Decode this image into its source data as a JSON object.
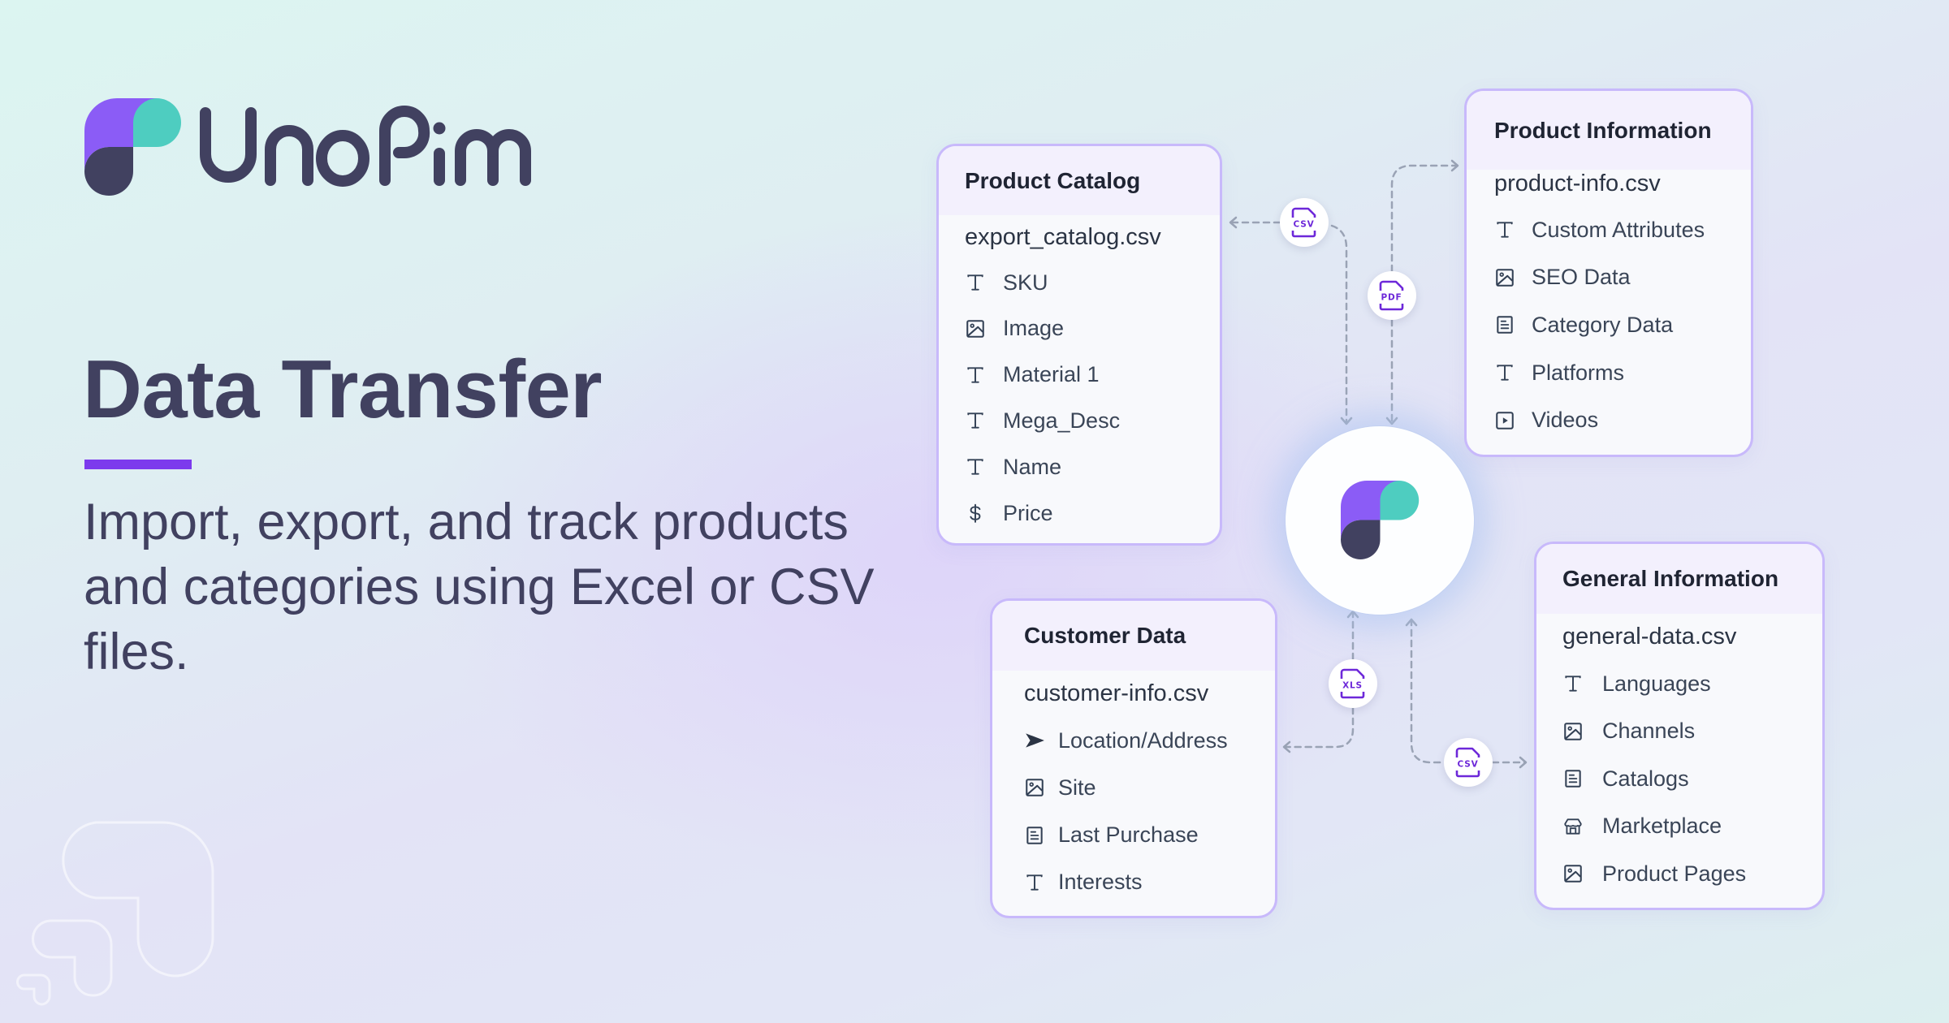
{
  "brand": {
    "name": "UnoPim",
    "colors": {
      "purple": "#8b5cf6",
      "teal": "#4ecdc0",
      "navy": "#414160",
      "accent": "#7c3aed"
    }
  },
  "hero": {
    "headline": "Data Transfer",
    "subtitle": "Import, export, and track products and categories using Excel or CSV files."
  },
  "hub": {
    "icon": "unopim-logo-mark"
  },
  "cards": {
    "product_catalog": {
      "title": "Product Catalog",
      "file": "export_catalog.csv",
      "fields": [
        {
          "icon": "text-icon",
          "label": "SKU"
        },
        {
          "icon": "image-icon",
          "label": "Image"
        },
        {
          "icon": "text-icon",
          "label": "Material 1"
        },
        {
          "icon": "text-icon",
          "label": "Mega_Desc"
        },
        {
          "icon": "text-icon",
          "label": "Name"
        },
        {
          "icon": "dollar-icon",
          "label": "Price"
        }
      ]
    },
    "product_information": {
      "title": "Product Information",
      "file": "product-info.csv",
      "fields": [
        {
          "icon": "text-icon",
          "label": "Custom Attributes"
        },
        {
          "icon": "image-icon",
          "label": "SEO Data"
        },
        {
          "icon": "document-icon",
          "label": "Category Data"
        },
        {
          "icon": "text-icon",
          "label": "Platforms"
        },
        {
          "icon": "video-icon",
          "label": "Videos"
        }
      ]
    },
    "customer_data": {
      "title": "Customer Data",
      "file": "customer-info.csv",
      "fields": [
        {
          "icon": "navigation-arrow-icon",
          "label": "Location/Address"
        },
        {
          "icon": "image-icon",
          "label": "Site"
        },
        {
          "icon": "document-icon",
          "label": "Last Purchase"
        },
        {
          "icon": "text-icon",
          "label": "Interests"
        }
      ]
    },
    "general_information": {
      "title": "General Information",
      "file": "general-data.csv",
      "fields": [
        {
          "icon": "text-icon",
          "label": "Languages"
        },
        {
          "icon": "image-icon",
          "label": "Channels"
        },
        {
          "icon": "document-icon",
          "label": "Catalogs"
        },
        {
          "icon": "storefront-icon",
          "label": "Marketplace"
        },
        {
          "icon": "image-icon",
          "label": "Product Pages"
        }
      ]
    }
  },
  "badges": {
    "catalog": "CSV",
    "product_info": "PDF",
    "customer": "XLS",
    "general": "CSV"
  }
}
